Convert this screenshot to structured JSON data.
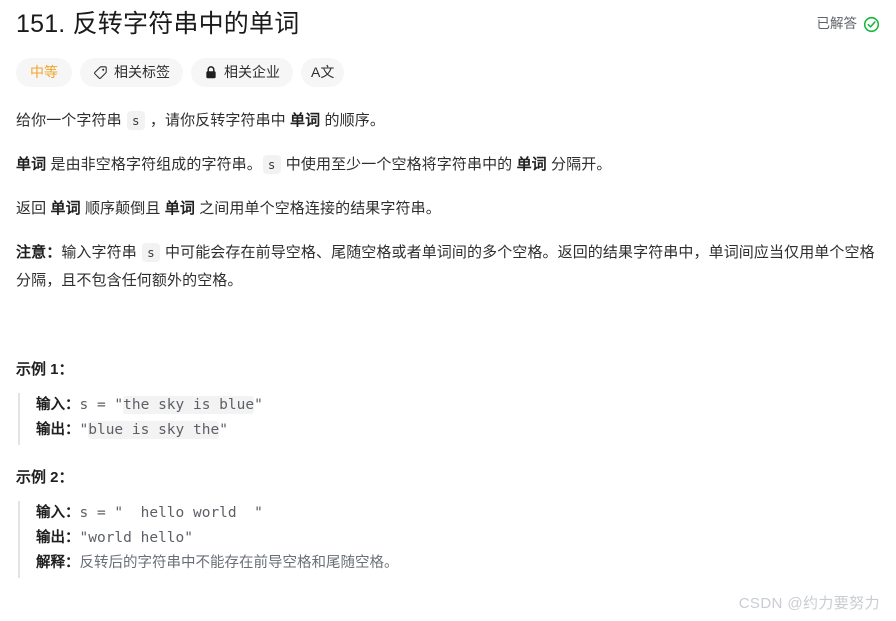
{
  "header": {
    "title": "151. 反转字符串中的单词",
    "status_label": "已解答",
    "status_icon": "check-circle-icon",
    "status_color": "#16b63c"
  },
  "tags": {
    "difficulty": {
      "label": "中等",
      "color": "#f0a62a"
    },
    "topics": {
      "label": "相关标签",
      "icon": "tag-icon"
    },
    "companies": {
      "label": "相关企业",
      "icon": "lock-icon"
    },
    "translate": {
      "label": "A文",
      "icon": "translate-icon"
    }
  },
  "description": {
    "p1": {
      "t1": "给你一个字符串 ",
      "code1": "s",
      "t2": " ，请你反转字符串中 ",
      "b1": "单词",
      "t3": " 的顺序。"
    },
    "p2": {
      "b1": "单词",
      "t1": " 是由非空格字符组成的字符串。",
      "code1": "s",
      "t2": " 中使用至少一个空格将字符串中的 ",
      "b2": "单词",
      "t3": " 分隔开。"
    },
    "p3": {
      "t1": "返回 ",
      "b1": "单词",
      "t2": " 顺序颠倒且 ",
      "b2": "单词",
      "t3": " 之间用单个空格连接的结果字符串。"
    },
    "p4": {
      "b1": "注意：",
      "t1": "输入字符串 ",
      "code1": "s",
      "t2": " 中可能会存在前导空格、尾随空格或者单词间的多个空格。返回的结果字符串中，单词间应当仅用单个空格分隔，且不包含任何额外的空格。"
    }
  },
  "examples": [
    {
      "title": "示例 1：",
      "input_label": "输入：",
      "input_prefix": "s = \"",
      "input_value": "the sky is blue",
      "input_suffix": "\"",
      "output_label": "输出：",
      "output_prefix": "\"",
      "output_value": "blue is sky the",
      "output_suffix": "\""
    },
    {
      "title": "示例 2：",
      "input_label": "输入：",
      "input_text": "s = \"  hello world  \"",
      "output_label": "输出：",
      "output_text": "\"world hello\"",
      "explain_label": "解释：",
      "explain_text": "反转后的字符串中不能存在前导空格和尾随空格。"
    }
  ],
  "watermark": "CSDN @约力要努力"
}
